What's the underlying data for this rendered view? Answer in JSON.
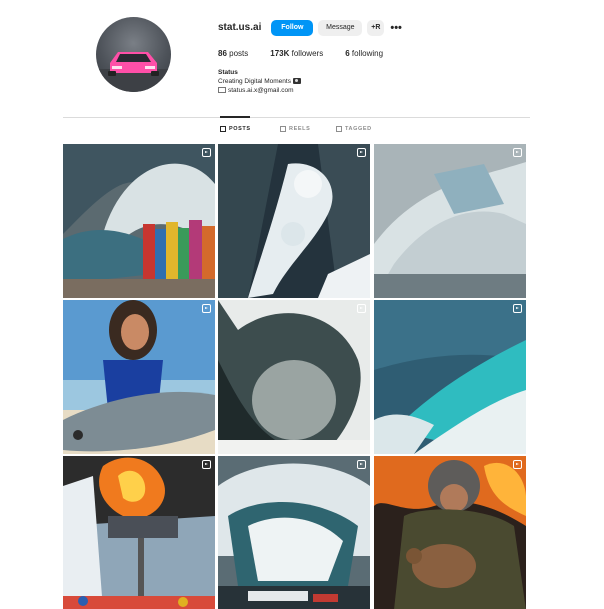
{
  "profile": {
    "username": "stat.us.ai",
    "follow_label": "Follow",
    "message_label": "Message",
    "adduser_label": "+R",
    "more_label": "•••",
    "stats": {
      "posts": "86",
      "posts_label": "posts",
      "followers": "173K",
      "followers_label": "followers",
      "following": "6",
      "following_label": "following"
    },
    "bio": {
      "name": "Status",
      "tagline": "Creating Digital Moments",
      "email": "status.ai.x@gmail.com"
    }
  },
  "tabs": [
    {
      "label": "POSTS",
      "active": true
    },
    {
      "label": "REELS",
      "active": false
    },
    {
      "label": "TAGGED",
      "active": false
    }
  ],
  "posts": [
    {
      "subject": "giant wave over colorful houses",
      "reel": true
    },
    {
      "subject": "aerial waterfall over dark cliffs",
      "reel": true
    },
    {
      "subject": "glacier collapse",
      "reel": true
    },
    {
      "subject": "girl with seal on beach",
      "reel": true
    },
    {
      "subject": "dark wave curl",
      "reel": true
    },
    {
      "subject": "turquoise ocean wave",
      "reel": true
    },
    {
      "subject": "burning ski lift",
      "reel": true
    },
    {
      "subject": "wave over ship",
      "reel": true
    },
    {
      "subject": "firefighter holding fawn",
      "reel": true
    }
  ],
  "colors": {
    "accent": "#0095f6",
    "avatar_car": "#ff4fa8"
  }
}
